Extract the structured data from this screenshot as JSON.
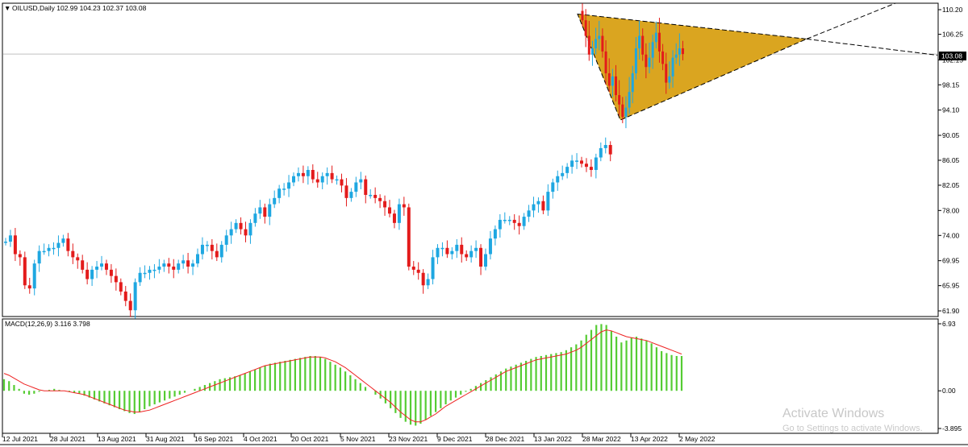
{
  "header": {
    "symbol_info": "OILUSD,Daily  102.99 104.23 102.37 103.08"
  },
  "macd": {
    "label": "MACD(12,26,9) 3.116 3.798",
    "axis": [
      "6.93",
      "0.00",
      "-3.895"
    ],
    "range": [
      -3.895,
      6.93
    ]
  },
  "price": {
    "last": "103.08",
    "last_value": 103.08
  },
  "y_axis": {
    "ticks": [
      "110.20",
      "106.25",
      "102.15",
      "98.15",
      "94.10",
      "90.05",
      "86.05",
      "82.05",
      "78.00",
      "74.00",
      "69.95",
      "65.95",
      "61.90"
    ]
  },
  "x_axis": {
    "ticks": [
      "12 Jul 2021",
      "28 Jul 2021",
      "13 Aug 2021",
      "31 Aug 2021",
      "16 Sep 2021",
      "4 Oct 2021",
      "20 Oct 2021",
      "5 Nov 2021",
      "23 Nov 2021",
      "9 Dec 2021",
      "28 Dec 2021",
      "13 Jan 2022",
      "28 Mar 2022",
      "13 Apr 2022",
      "2 May 2022"
    ]
  },
  "watermark": {
    "title": "Activate Windows",
    "subtitle": "Go to Settings to activate Windows."
  },
  "colors": {
    "bull": "#1ea7e1",
    "bear": "#e31b1b",
    "triangle_fill": "#daa520",
    "macd_hist": "#55cc33",
    "signal": "#ee2222"
  },
  "chart_data": {
    "type": "candlestick",
    "ylim": [
      61.9,
      110.2
    ],
    "price_start": 73.0,
    "closes": [
      73.0,
      74.0,
      71.0,
      70.5,
      66.0,
      65.5,
      69.5,
      71.5,
      71.5,
      72.0,
      72.0,
      72.8,
      73.5,
      71.5,
      70.5,
      70.0,
      68.5,
      67.0,
      68.5,
      69.0,
      69.5,
      68.5,
      67.5,
      66.5,
      65.0,
      63.5,
      62.0,
      66.5,
      68.0,
      68.0,
      68.5,
      68.5,
      69.0,
      69.5,
      69.0,
      68.5,
      69.5,
      70.0,
      69.0,
      69.5,
      71.0,
      72.5,
      72.5,
      71.5,
      70.5,
      72.5,
      74.0,
      75.0,
      76.0,
      75.0,
      74.0,
      76.0,
      77.5,
      78.5,
      77.0,
      79.0,
      80.0,
      81.5,
      81.5,
      82.5,
      83.5,
      84.0,
      83.5,
      84.5,
      83.0,
      82.5,
      83.5,
      84.0,
      83.0,
      83.0,
      82.0,
      80.0,
      81.0,
      82.5,
      83.0,
      80.5,
      80.5,
      80.0,
      79.5,
      78.5,
      77.5,
      76.0,
      79.0,
      78.5,
      69.0,
      68.5,
      68.0,
      66.0,
      67.0,
      70.5,
      72.0,
      72.0,
      71.0,
      71.5,
      72.5,
      71.0,
      70.5,
      71.5,
      72.0,
      69.0,
      71.0,
      73.5,
      75.0,
      76.5,
      76.5,
      76.5,
      76.0,
      75.5,
      77.0,
      78.0,
      79.0,
      79.5,
      78.0,
      81.0,
      82.5,
      83.5,
      84.0,
      85.0,
      86.0,
      86.0,
      85.5,
      85.0,
      84.5,
      86.5,
      88.0,
      88.5,
      87.0,
      null,
      null,
      null,
      null,
      null,
      null,
      null,
      null,
      null,
      null,
      null,
      null,
      null,
      null,
      null,
      null,
      null,
      null,
      null,
      null,
      null,
      null,
      null,
      null,
      null,
      null,
      null,
      null,
      null,
      null,
      null,
      null,
      null,
      null,
      null,
      null,
      null,
      null,
      null,
      null,
      null,
      null,
      null,
      null,
      null,
      null,
      null,
      null,
      null,
      null,
      null,
      null,
      null,
      null,
      null,
      null,
      null,
      null,
      null,
      null,
      null,
      null,
      null,
      null,
      null,
      null,
      null,
      null,
      null,
      null,
      null,
      null,
      null,
      null,
      null,
      null,
      null,
      null,
      null,
      null,
      null,
      null,
      null,
      null,
      null,
      null,
      null,
      null,
      null,
      null,
      null,
      null
    ],
    "recent_closes": [
      108.5,
      106.0,
      103.0,
      104.0,
      105.5,
      106.0,
      103.5,
      100.0,
      98.0,
      99.5,
      96.5,
      95.0,
      93.0,
      94.5,
      97.0,
      100.0,
      104.0,
      106.0,
      103.0,
      101.0,
      102.5,
      105.0,
      106.5,
      103.5,
      101.5,
      98.5,
      99.5,
      102.5,
      103.0,
      104.0,
      103.08
    ],
    "triangle": {
      "apex_top": 109.5,
      "apex_bottom": 92.5,
      "meet": 105.5
    },
    "macd_hist": [
      1.2,
      1.0,
      0.6,
      0.2,
      -0.3,
      -0.4,
      -0.3,
      -0.1,
      0.0,
      0.1,
      0.2,
      0.1,
      0.0,
      -0.1,
      -0.2,
      -0.3,
      -0.5,
      -0.7,
      -0.9,
      -1.1,
      -1.3,
      -1.5,
      -1.7,
      -1.9,
      -2.1,
      -2.3,
      -2.4,
      -2.2,
      -1.9,
      -1.6,
      -1.4,
      -1.2,
      -1.0,
      -0.8,
      -0.6,
      -0.4,
      -0.2,
      0.0,
      0.2,
      0.4,
      0.6,
      0.8,
      1.0,
      1.2,
      1.3,
      1.4,
      1.5,
      1.6,
      1.8,
      2.0,
      2.2,
      2.4,
      2.6,
      2.8,
      2.9,
      3.0,
      3.1,
      3.2,
      3.3,
      3.4,
      3.5,
      3.6,
      3.6,
      3.5,
      3.3,
      3.0,
      2.7,
      2.4,
      2.0,
      1.6,
      1.2,
      0.8,
      0.4,
      0.0,
      -0.4,
      -0.8,
      -1.3,
      -1.8,
      -2.3,
      -2.8,
      -3.2,
      -3.5,
      -3.6,
      -3.4,
      -3.0,
      -2.6,
      -2.2,
      -1.8,
      -1.4,
      -1.0,
      -0.7,
      -0.4,
      -0.1,
      0.2,
      0.5,
      0.8,
      1.1,
      1.4,
      1.7,
      2.0,
      2.3,
      2.5,
      2.7,
      2.9,
      3.1,
      3.3,
      3.5,
      3.6,
      3.7,
      3.8,
      3.9,
      4.0,
      4.2,
      4.5,
      4.8,
      5.2,
      5.8,
      6.3,
      6.8,
      6.9,
      6.8,
      6.2,
      5.6,
      5.0,
      5.2,
      5.5,
      5.6,
      5.4,
      5.2,
      4.9,
      4.5,
      4.1,
      3.9,
      3.7,
      3.6,
      3.6
    ],
    "macd_signal": [
      1.8,
      1.6,
      1.3,
      1.0,
      0.7,
      0.5,
      0.3,
      0.1,
      0.0,
      0.0,
      0.0,
      0.0,
      0.0,
      -0.1,
      -0.2,
      -0.3,
      -0.4,
      -0.6,
      -0.8,
      -1.0,
      -1.2,
      -1.4,
      -1.6,
      -1.8,
      -2.0,
      -2.1,
      -2.2,
      -2.2,
      -2.1,
      -2.0,
      -1.8,
      -1.6,
      -1.4,
      -1.2,
      -1.0,
      -0.8,
      -0.6,
      -0.4,
      -0.2,
      0.0,
      0.2,
      0.4,
      0.6,
      0.8,
      1.0,
      1.2,
      1.4,
      1.6,
      1.8,
      2.0,
      2.2,
      2.4,
      2.6,
      2.7,
      2.8,
      2.9,
      3.0,
      3.1,
      3.2,
      3.3,
      3.4,
      3.5,
      3.5,
      3.5,
      3.4,
      3.2,
      3.0,
      2.7,
      2.4,
      2.0,
      1.6,
      1.2,
      0.8,
      0.4,
      0.0,
      -0.4,
      -0.8,
      -1.2,
      -1.7,
      -2.2,
      -2.6,
      -3.0,
      -3.2,
      -3.2,
      -3.0,
      -2.7,
      -2.4,
      -2.0,
      -1.6,
      -1.3,
      -1.0,
      -0.7,
      -0.4,
      -0.1,
      0.2,
      0.5,
      0.8,
      1.1,
      1.4,
      1.7,
      2.0,
      2.2,
      2.4,
      2.6,
      2.8,
      3.0,
      3.2,
      3.3,
      3.4,
      3.5,
      3.6,
      3.7,
      3.8,
      4.0,
      4.2,
      4.5,
      4.9,
      5.3,
      5.7,
      6.1,
      6.3,
      6.2,
      6.0,
      5.8,
      5.6,
      5.5,
      5.4,
      5.3,
      5.2,
      5.0,
      4.8,
      4.6,
      4.4,
      4.2,
      4.0,
      3.8
    ]
  }
}
